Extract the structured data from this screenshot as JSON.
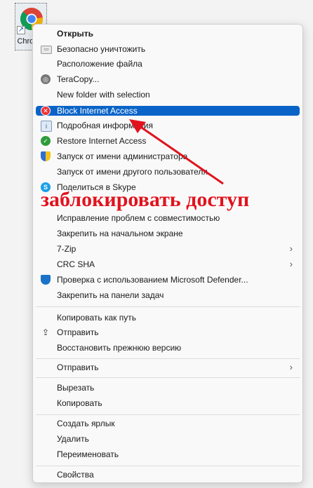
{
  "desktop_icon": {
    "label": "Chrome"
  },
  "menu": {
    "items": [
      {
        "label": "Открыть",
        "icon": "none",
        "bold": true
      },
      {
        "label": "Безопасно уничтожить",
        "icon": "shredder-icon"
      },
      {
        "label": "Расположение файла",
        "icon": "none"
      },
      {
        "label": "TeraCopy...",
        "icon": "teracopy-icon"
      },
      {
        "label": "New folder with selection",
        "icon": "none"
      },
      {
        "label": "Block Internet Access",
        "icon": "block-icon",
        "selected": true
      },
      {
        "label": "Подробная информация",
        "icon": "info-icon"
      },
      {
        "label": "Restore Internet Access",
        "icon": "shield-check-icon"
      },
      {
        "label": "Запуск от имени администратора",
        "icon": "uac-shield-icon"
      },
      {
        "label": "Запуск от имени другого пользователя",
        "icon": "none"
      },
      {
        "label": "Поделиться в Skype",
        "icon": "skype-icon"
      },
      {
        "label": "Исправление проблем с совместимостью",
        "icon": "none"
      },
      {
        "label": "Закрепить на начальном экране",
        "icon": "none"
      },
      {
        "label": "7-Zip",
        "icon": "none",
        "submenu": true
      },
      {
        "label": "CRC SHA",
        "icon": "none",
        "submenu": true
      },
      {
        "label": "Проверка с использованием Microsoft Defender...",
        "icon": "defender-icon"
      },
      {
        "label": "Закрепить на панели задач",
        "icon": "none"
      },
      {
        "label": "Копировать как путь",
        "icon": "none"
      },
      {
        "label": "Отправить",
        "icon": "share-icon"
      },
      {
        "label": "Восстановить прежнюю версию",
        "icon": "none"
      },
      {
        "label": "Отправить",
        "icon": "none",
        "submenu": true
      },
      {
        "label": "Вырезать",
        "icon": "none"
      },
      {
        "label": "Копировать",
        "icon": "none"
      },
      {
        "label": "Создать ярлык",
        "icon": "none"
      },
      {
        "label": "Удалить",
        "icon": "none"
      },
      {
        "label": "Переименовать",
        "icon": "none"
      },
      {
        "label": "Свойства",
        "icon": "none"
      }
    ]
  },
  "overlay": {
    "text": "заблокировать доступ",
    "color": "#e0141e"
  },
  "colors": {
    "selection": "#0a64c8",
    "menu_bg": "#f9f9f9"
  }
}
